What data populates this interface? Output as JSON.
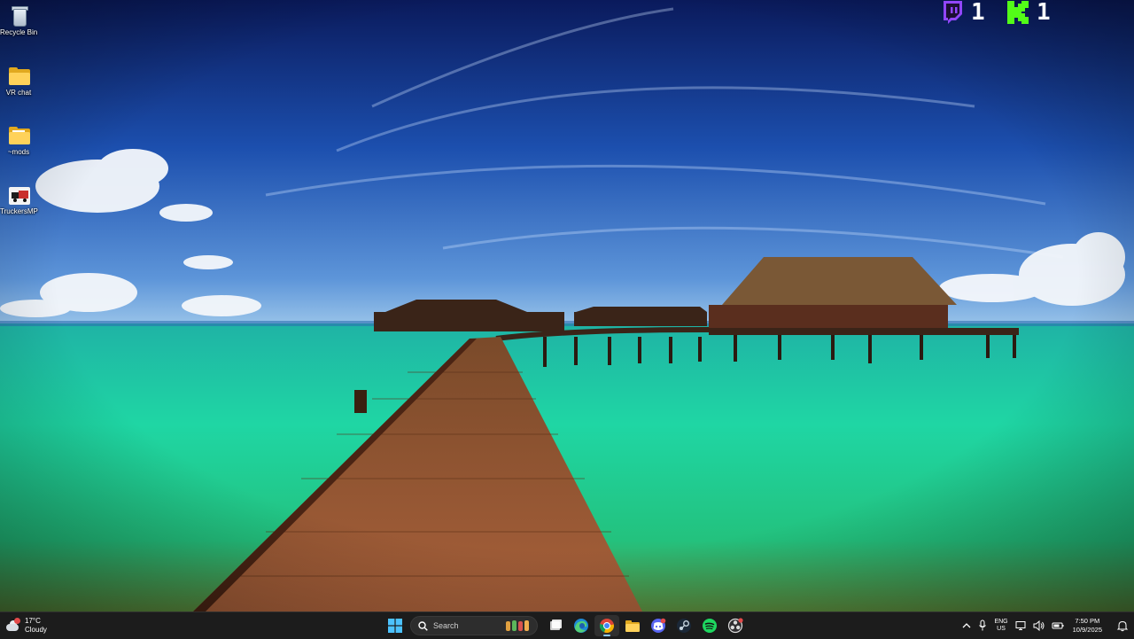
{
  "desktop": {
    "icons": [
      {
        "label": "Recycle Bin",
        "icon": "recycle-bin-icon"
      },
      {
        "label": "VR chat",
        "icon": "folder-icon"
      },
      {
        "label": "~mods",
        "icon": "folder-icon"
      },
      {
        "label": "TruckersMP",
        "icon": "truckersmp-icon"
      }
    ]
  },
  "overlay": {
    "twitch_count": "1",
    "kick_count": "1",
    "twitch_color": "#9146ff",
    "kick_color": "#53fc18"
  },
  "taskbar": {
    "weather": {
      "temp": "17°C",
      "condition": "Cloudy"
    },
    "search": {
      "placeholder": "Search"
    },
    "apps": [
      {
        "name": "start",
        "icon": "windows-start-icon"
      },
      {
        "name": "task-view",
        "icon": "task-view-icon"
      },
      {
        "name": "edge",
        "icon": "edge-icon"
      },
      {
        "name": "chrome",
        "icon": "chrome-icon",
        "active": true
      },
      {
        "name": "file-explorer",
        "icon": "folder-icon"
      },
      {
        "name": "discord",
        "icon": "discord-icon"
      },
      {
        "name": "steam",
        "icon": "steam-icon"
      },
      {
        "name": "spotify",
        "icon": "spotify-icon"
      },
      {
        "name": "obs",
        "icon": "obs-icon"
      }
    ],
    "tray": {
      "language": "ENG",
      "region": "US",
      "time": "7:50 PM",
      "date": "10/9/2025"
    },
    "accent": "#8ac8ff"
  }
}
